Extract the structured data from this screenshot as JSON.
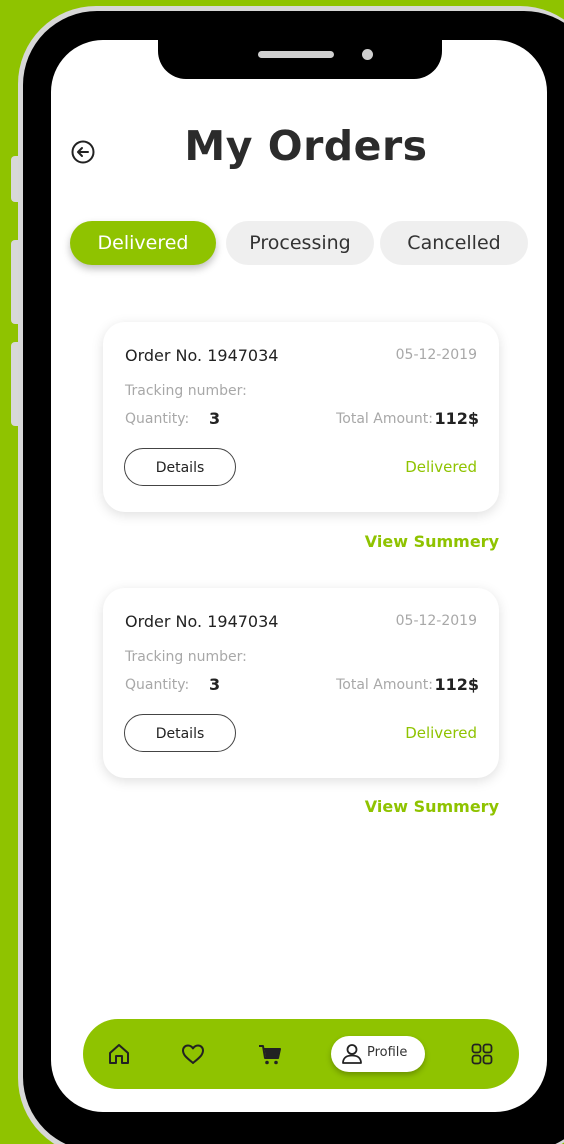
{
  "header": {
    "title": "My Orders"
  },
  "tabs": [
    {
      "label": "Delivered",
      "active": true
    },
    {
      "label": "Processing",
      "active": false
    },
    {
      "label": "Cancelled",
      "active": false
    }
  ],
  "orders": [
    {
      "order_no": "Order No. 1947034",
      "date": "05-12-2019",
      "tracking_label": "Tracking number:",
      "quantity_label": "Quantity:",
      "quantity": "3",
      "total_label": "Total Amount:",
      "total": "112$",
      "details_label": "Details",
      "status": "Delivered",
      "view_summary": "View Summery"
    },
    {
      "order_no": "Order No. 1947034",
      "date": "05-12-2019",
      "tracking_label": "Tracking number:",
      "quantity_label": "Quantity:",
      "quantity": "3",
      "total_label": "Total Amount:",
      "total": "112$",
      "details_label": "Details",
      "status": "Delivered",
      "view_summary": "View Summery"
    }
  ],
  "bottom_nav": {
    "items": [
      {
        "icon": "home-icon"
      },
      {
        "icon": "heart-icon"
      },
      {
        "icon": "cart-icon"
      },
      {
        "icon": "profile-icon",
        "label": "Profile",
        "active": true
      },
      {
        "icon": "grid-icon"
      }
    ]
  },
  "colors": {
    "accent": "#8fc300",
    "background": "#8fc300",
    "text": "#2b2b2b",
    "muted": "#a8a8a8"
  }
}
